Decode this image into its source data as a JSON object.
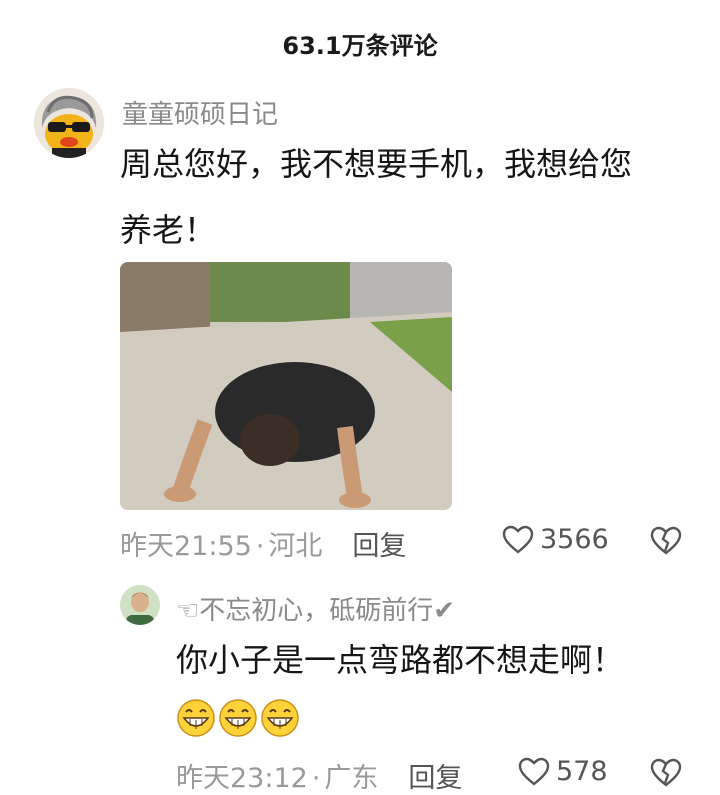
{
  "header": {
    "title": "63.1万条评论"
  },
  "comment": {
    "username": "童童硕硕日记",
    "text_line1": "周总您好，我不想要手机，我想给您",
    "text_line2": "养老！",
    "time": "昨天21:55",
    "sep": "·",
    "location": "河北",
    "reply_label": "回复",
    "likes": "3566"
  },
  "reply": {
    "username": "☜不忘初心，砥砺前行✔",
    "text": "你小子是一点弯路都不想走啊！",
    "emoji_count": 3,
    "time": "昨天23:12",
    "sep": "·",
    "location": "广东",
    "reply_label": "回复",
    "likes": "578"
  },
  "colors": {
    "username": "#8a8a8a",
    "meta": "#9a9a9a",
    "icon": "#555555"
  }
}
